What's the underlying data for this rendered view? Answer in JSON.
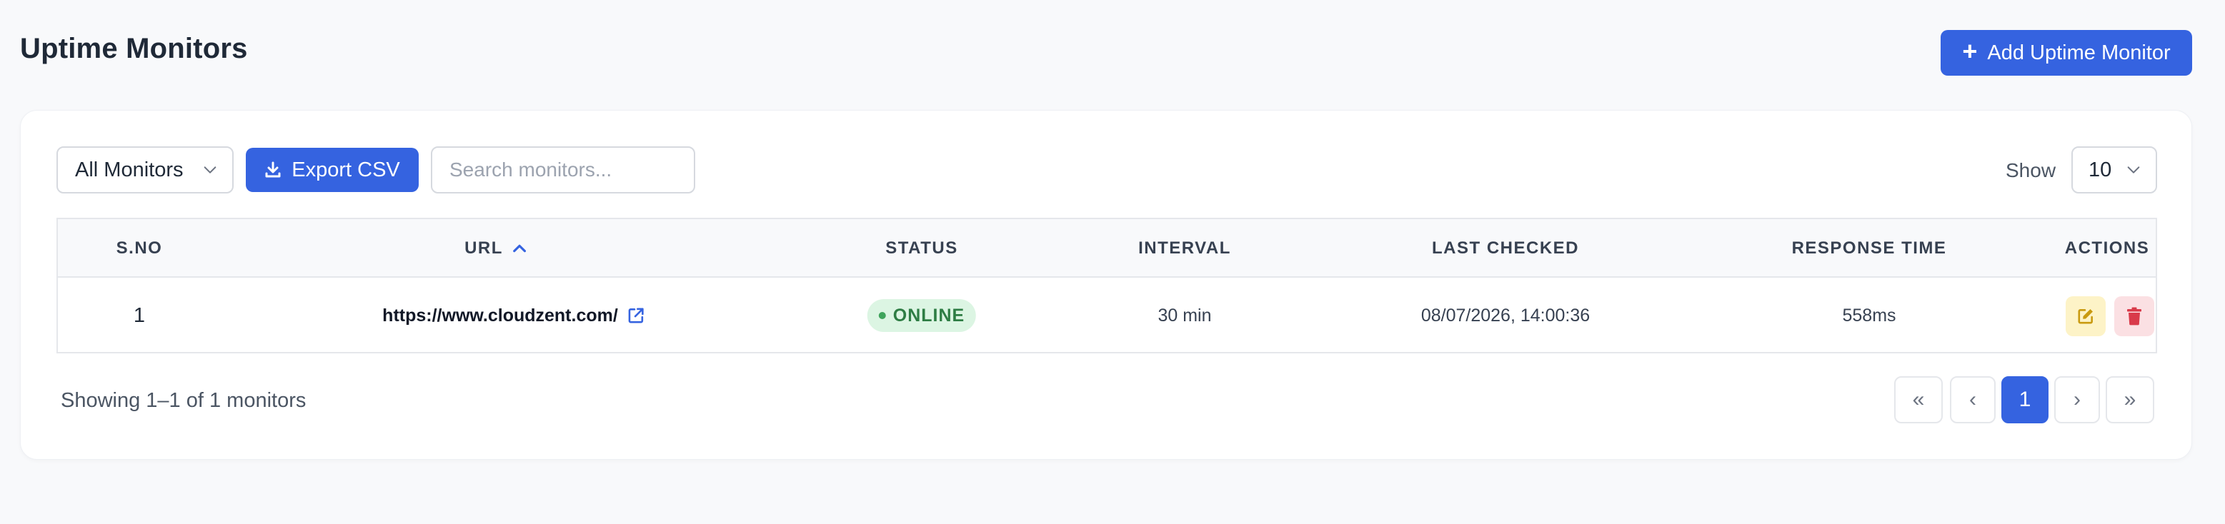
{
  "header": {
    "title": "Uptime Monitors",
    "add_button_label": "Add Uptime Monitor"
  },
  "toolbar": {
    "filter_value": "All Monitors",
    "export_label": "Export CSV",
    "search_placeholder": "Search monitors...",
    "show_label": "Show",
    "page_size": "10"
  },
  "table": {
    "columns": [
      "S.NO",
      "URL",
      "STATUS",
      "INTERVAL",
      "LAST CHECKED",
      "RESPONSE TIME",
      "ACTIONS"
    ],
    "sorted_column": "URL",
    "sort_direction": "ascending",
    "rows": [
      {
        "sno": "1",
        "url": "https://www.cloudzent.com/",
        "status": "ONLINE",
        "interval": "30 min",
        "last_checked": "08/07/2026, 14:00:36",
        "response_time": "558ms"
      }
    ]
  },
  "footer": {
    "summary": "Showing 1–1 of 1 monitors",
    "pagination": {
      "first": "«",
      "prev": "‹",
      "current": "1",
      "next": "›",
      "last": "»"
    }
  },
  "colors": {
    "primary": "#3563e0",
    "status_online_bg": "#dcf5e3",
    "status_online_text": "#2e7d44",
    "edit_bg": "#fdf3c7",
    "edit_icon": "#c99a10",
    "delete_bg": "#fbe0e3",
    "delete_icon": "#d93a4a"
  },
  "icons": {
    "add": "plus-icon",
    "export": "download-icon",
    "dropdown": "chevron-down-icon",
    "sort": "chevron-up-icon",
    "external_link": "external-link-icon",
    "edit": "edit-icon",
    "delete": "trash-icon"
  }
}
